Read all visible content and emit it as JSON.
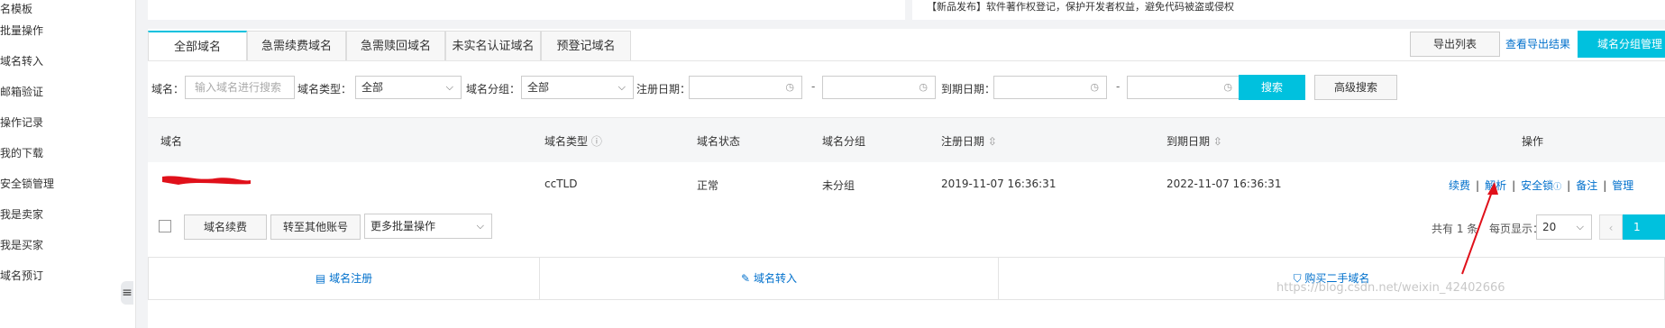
{
  "sidebar": {
    "items": [
      {
        "label": "名模板"
      },
      {
        "label": "批量操作"
      },
      {
        "label": "域名转入"
      },
      {
        "label": "邮箱验证"
      },
      {
        "label": "操作记录"
      },
      {
        "label": "我的下载"
      },
      {
        "label": "安全锁管理"
      },
      {
        "label": "我是卖家"
      },
      {
        "label": "我是买家"
      },
      {
        "label": "域名预订"
      }
    ],
    "collapse_icon": "≡"
  },
  "notice": {
    "text": "【新品发布】软件著作权登记，保护开发者权益，避免代码被盗或侵权"
  },
  "tabs": [
    "全部域名",
    "急需续费域名",
    "急需赎回域名",
    "未实名认证域名",
    "预登记域名"
  ],
  "toolbar": {
    "export_list": "导出列表",
    "view_export": "查看导出结果",
    "group_manage": "域名分组管理"
  },
  "filters": {
    "domain_label": "域名：",
    "domain_placeholder": "输入域名进行搜索",
    "type_label": "域名类型：",
    "type_value": "全部",
    "group_label": "域名分组：",
    "group_value": "全部",
    "reg_date_label": "注册日期：",
    "expire_date_label": "到期日期：",
    "dash": "-",
    "search_button": "搜索",
    "advanced_button": "高级搜索"
  },
  "table": {
    "headers": [
      "域名",
      "域名类型",
      "域名状态",
      "域名分组",
      "注册日期",
      "到期日期",
      "操作"
    ],
    "rows": [
      {
        "domain_type": "ccTLD",
        "status": "正常",
        "group": "未分组",
        "reg_date": "2019-11-07 16:36:31",
        "expire_date": "2022-11-07 16:36:31",
        "actions": [
          "续费",
          "解析",
          "安全锁",
          "备注",
          "管理"
        ]
      }
    ]
  },
  "bulk": {
    "renew_button": "域名续费",
    "transfer_button": "转至其他账号",
    "more_ops": "更多批量操作"
  },
  "pagination": {
    "total": "共有 1 条",
    "page_size_label": "每页显示：",
    "page_size": "20",
    "prev": "‹",
    "current": "1"
  },
  "quick_links": [
    {
      "icon": "▤",
      "label": "域名注册"
    },
    {
      "icon": "✎",
      "label": "域名转入"
    },
    {
      "icon": "⛉",
      "label": "购买二手域名"
    }
  ],
  "watermark": "https://blog.csdn.net/weixin_42402666",
  "colors": {
    "accent": "#00c1de",
    "link": "#0070cc",
    "annotation": "#e0101a"
  }
}
